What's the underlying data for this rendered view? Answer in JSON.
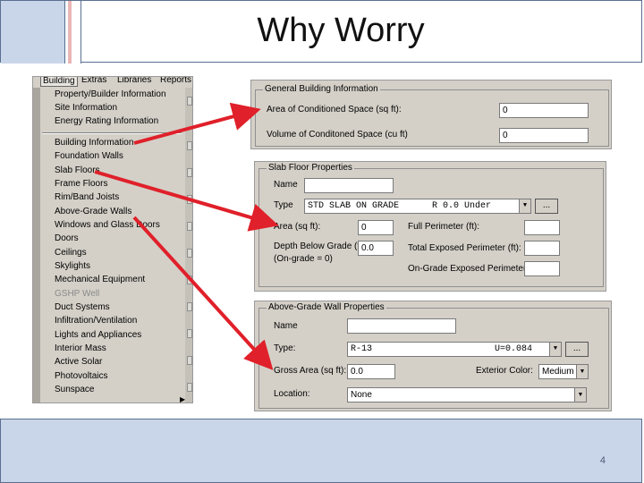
{
  "slide": {
    "title": "Why Worry",
    "page_number": "4"
  },
  "menu": {
    "menubar": [
      "Building",
      "Extras",
      "Libraries",
      "Reports"
    ],
    "group1": [
      "Property/Builder Information",
      "Site Information",
      "Energy Rating Information"
    ],
    "group2": [
      "Building Information",
      "Foundation Walls",
      "Slab Floors",
      "Frame Floors",
      "Rim/Band Joists",
      "Above-Grade Walls",
      "Windows and Glass Doors",
      "Doors",
      "Ceilings",
      "Skylights",
      "Mechanical Equipment",
      "GSHP Well",
      "Duct Systems",
      "Infiltration/Ventilation",
      "Lights and Appliances",
      "Interior Mass",
      "Active Solar",
      "Photovoltaics",
      "Sunspace"
    ]
  },
  "general": {
    "legend": "General Building Information",
    "area_label": "Area of Conditioned Space (sq ft):",
    "area_value": "0",
    "volume_label": "Volume of Conditoned Space (cu ft)",
    "volume_value": "0"
  },
  "slab": {
    "legend": "Slab Floor Properties",
    "name_label": "Name",
    "name_value": "",
    "type_label": "Type",
    "type_value": "STD SLAB ON GRADE",
    "type_rvalue": "R 0.0 Under",
    "ellipsis": "...",
    "area_label": "Area (sq ft):",
    "area_value": "0",
    "depth_label": "Depth Below Grade (ft):",
    "depth_label2": "(On-grade = 0)",
    "depth_value": "0.0",
    "full_perim_label": "Full Perimeter (ft):",
    "full_perim_value": "",
    "exposed_perim_label": "Total Exposed Perimeter (ft):",
    "exposed_perim_value": "",
    "ongrade_perim_label": "On-Grade Exposed Perimeter (ft):",
    "ongrade_perim_value": ""
  },
  "wall": {
    "legend": "Above-Grade Wall Properties",
    "name_label": "Name",
    "name_value": "",
    "type_label": "Type:",
    "type_value": "R-13",
    "type_uvalue": "U=0.084",
    "ellipsis": "...",
    "area_label": "Gross Area (sq ft):",
    "area_value": "0.0",
    "color_label": "Exterior Color:",
    "color_value": "Medium",
    "location_label": "Location:",
    "location_value": "None"
  },
  "colors": {
    "arrow": "#e0202a",
    "title_box": "#c9d6e9",
    "dialog": "#d4d0c8"
  }
}
